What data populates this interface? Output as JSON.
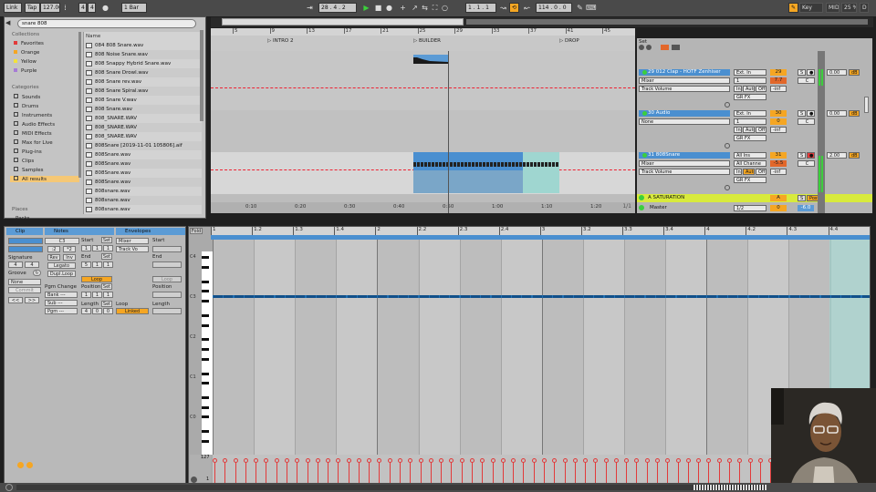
{
  "transport": {
    "link": "Link",
    "tap": "Tap",
    "tempo": "127.00",
    "sig_num": "4",
    "sig_den": "4",
    "metro": "1 Bar",
    "position": "28 .  4 .  2",
    "loop_start": "1 .  1 .  1",
    "loop_len": "114 .  0 .  0",
    "key_label": "Key",
    "midi_label": "MIDI",
    "cpu": "25 %",
    "drive": "D"
  },
  "browser": {
    "search_value": "snare 808",
    "collections_heading": "Collections",
    "collections": [
      "Favorites",
      "Orange",
      "Yellow",
      "Purple"
    ],
    "collection_colors": [
      "#e23a3a",
      "#f5a623",
      "#f2e23b",
      "#a67bd6"
    ],
    "categories_heading": "Categories",
    "categories": [
      "Sounds",
      "Drums",
      "Instruments",
      "Audio Effects",
      "MIDI Effects",
      "Max for Live",
      "Plug-ins",
      "Clips",
      "Samples",
      "All results"
    ],
    "places_heading": "Places",
    "places_item": "Packs",
    "name_header": "Name",
    "files": [
      "084 808 Snare.wav",
      "808 Noise Snare.wav",
      "808 Snappy Hybrid Snare.wav",
      "808 Snare Drowl.wav",
      "808 Snare rev.wav",
      "808 Snare Spiral.wav",
      "808 Snare V.wav",
      "808 Snare.wav",
      "808_SNARE.WAV",
      "808_SNARE.WAV",
      "808_SNARE.WAV",
      "808Snare [2019-11-01 105806].aif",
      "808Snare.wav",
      "808Snare.wav",
      "808Snare.wav",
      "808Snare.wav",
      "808snare.wav",
      "808snare.wav",
      "808snare.wav",
      "808snare.wav"
    ]
  },
  "arrangement": {
    "bar_numbers": [
      "5",
      "9",
      "13",
      "17",
      "21",
      "25",
      "29",
      "33",
      "37",
      "41",
      "45"
    ],
    "locators": [
      "INTRO 2",
      "BUILDER",
      "DROP"
    ],
    "time_labels": [
      "0:10",
      "0:20",
      "0:30",
      "0:40",
      "0:50",
      "1:00",
      "1:10",
      "1:20"
    ],
    "page_count": "1/1"
  },
  "mixer": {
    "set_label": "Set",
    "tracks": [
      {
        "name": "29 012 Clap - HOTF Zenhiser",
        "number": "29",
        "input": "Ext. In",
        "input_ch": "1",
        "monitor_in": "In",
        "monitor_auto": "Auto",
        "monitor_off": "Off",
        "device1": "Mixer",
        "device2": "Track Volume",
        "out": "GR FX",
        "vol": "7.7",
        "pan": "C",
        "send": "-inf",
        "peak": "0.00",
        "unit": "dB"
      },
      {
        "name": "30 Audio",
        "number": "30",
        "input": "Ext. In",
        "input_ch": "1",
        "monitor_in": "In",
        "monitor_auto": "Auto",
        "monitor_off": "Off",
        "device1": "None",
        "device2": "",
        "out": "GR FX",
        "vol": "0",
        "pan": "C",
        "send": "-inf",
        "peak": "0.00",
        "unit": "dB"
      },
      {
        "name": "31 808Snare",
        "number": "31",
        "input": "All Ins",
        "input_ch": "All Channe",
        "monitor_in": "In",
        "monitor_auto": "Auto",
        "monitor_off": "Off",
        "device1": "Mixer",
        "device2": "Track Volume",
        "out": "GR FX",
        "vol": "-5.5",
        "pan": "C",
        "send": "-inf",
        "peak": "2.00",
        "unit": "dB"
      }
    ],
    "return_name": "A SATURATION",
    "return_letter": "A",
    "return_post": "Post",
    "master_name": "Master",
    "master_ratio": "1/2",
    "master_vol": "0",
    "master_pan": "-6.0"
  },
  "clip_view": {
    "clip_tab": "Clip",
    "notes_tab": "Notes",
    "envelopes_tab": "Envelopes",
    "signature_label": "Signature",
    "sig_num": "4",
    "sig_den": "4",
    "groove_label": "Groove",
    "groove_value": "None",
    "commit": "Commit",
    "note_value": "C3",
    "btn_half": ":2",
    "btn_double": "*2",
    "btn_rev": "Rev",
    "btn_inv": "Inv",
    "btn_legato": "Legato",
    "btn_dupl": "Dupl.Loop",
    "pgm_label": "Pgm Change",
    "bank": "Bank ---",
    "sub": "Sub ---",
    "pgm": "Pgm ---",
    "start_label": "Start",
    "end_label": "End",
    "loop_label": "Loop",
    "position_label": "Position",
    "length_label": "Length",
    "set_label": "Set",
    "start_val": [
      "1",
      "1",
      "1"
    ],
    "end_val": [
      "5",
      "1",
      "1"
    ],
    "position_val": [
      "1",
      "1",
      "1"
    ],
    "length_val": [
      "4",
      "0",
      "0"
    ],
    "env_mixer": "Mixer",
    "env_track": "Track Vo",
    "linked": "Linked"
  },
  "piano_roll": {
    "fold": "Fold",
    "beat_labels": [
      "1",
      "1.2",
      "1.3",
      "1.4",
      "2",
      "2.2",
      "2.3",
      "2.4",
      "3",
      "3.2",
      "3.3",
      "3.4",
      "4",
      "4.2",
      "4.3",
      "4.4"
    ],
    "octave_labels": [
      "C4",
      "C3",
      "C2",
      "C1",
      "C0"
    ],
    "velocity_max": "127",
    "velocity_min": "1",
    "note_count": 64
  },
  "colors": {
    "accent": "#f5a623",
    "clip_blue": "#4a8fd0",
    "clip_teal": "#9fd6d0",
    "green": "#3ccf3c",
    "return_yellow": "#d8ea3c"
  }
}
